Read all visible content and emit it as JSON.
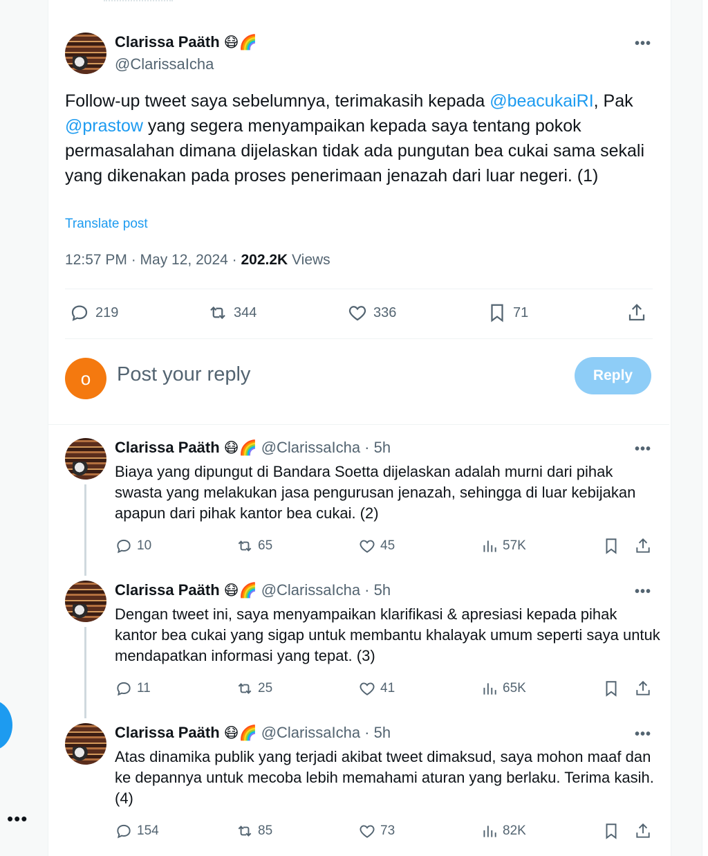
{
  "sidebar": {
    "more_label": "•••"
  },
  "tweet": {
    "author_name": "Clarissa Paäth",
    "author_emoji": "😷🌈",
    "handle": "@ClarissaIcha",
    "more_label": "•••",
    "text_parts": {
      "p1": "Follow-up tweet saya sebelumnya, terimakasih kepada ",
      "mention1": "@beacukaiRI",
      "p2": ", Pak ",
      "mention2": "@prastow",
      "p3": "  yang segera menyampaikan kepada saya tentang pokok permasalahan dimana dijelaskan tidak ada pungutan bea cukai sama sekali yang dikenakan pada proses penerimaan jenazah dari luar negeri. (1)"
    },
    "translate_label": "Translate post",
    "time": "12:57 PM · May 12, 2024 · ",
    "views_count": "202.2K",
    "views_label": " Views",
    "actions": {
      "replies": "219",
      "retweets": "344",
      "likes": "336",
      "bookmarks": "71"
    }
  },
  "reply_box": {
    "avatar_letter": "o",
    "placeholder": "Post your reply",
    "button_label": "Reply"
  },
  "replies": [
    {
      "author_name": "Clarissa Paäth",
      "author_emoji": "😷🌈",
      "handle_time": "@ClarissaIcha · 5h",
      "more_label": "•••",
      "text": "Biaya yang dipungut di Bandara Soetta dijelaskan adalah murni dari pihak swasta yang melakukan jasa pengurusan jenazah, sehingga di luar kebijakan apapun dari pihak kantor bea cukai. (2)",
      "replies": "10",
      "retweets": "65",
      "likes": "45",
      "views": "57K"
    },
    {
      "author_name": "Clarissa Paäth",
      "author_emoji": "😷🌈",
      "handle_time": "@ClarissaIcha · 5h",
      "more_label": "•••",
      "text": "Dengan tweet ini, saya menyampaikan klarifikasi & apresiasi kepada pihak kantor bea cukai yang sigap untuk membantu khalayak umum seperti saya untuk mendapatkan informasi yang tepat. (3)",
      "replies": "11",
      "retweets": "25",
      "likes": "41",
      "views": "65K"
    },
    {
      "author_name": "Clarissa Paäth",
      "author_emoji": "😷🌈",
      "handle_time": "@ClarissaIcha · 5h",
      "more_label": "•••",
      "text": "Atas dinamika publik yang terjadi akibat tweet dimaksud, saya mohon maaf dan ke depannya untuk mecoba lebih memahami aturan yang berlaku. Terima kasih. (4)",
      "replies": "154",
      "retweets": "85",
      "likes": "73",
      "views": "82K"
    }
  ],
  "colors": {
    "accent": "#1d9bf0",
    "reply_button": "#8ecdf7",
    "avatar_bg": "#f4790f",
    "muted": "#536471"
  }
}
